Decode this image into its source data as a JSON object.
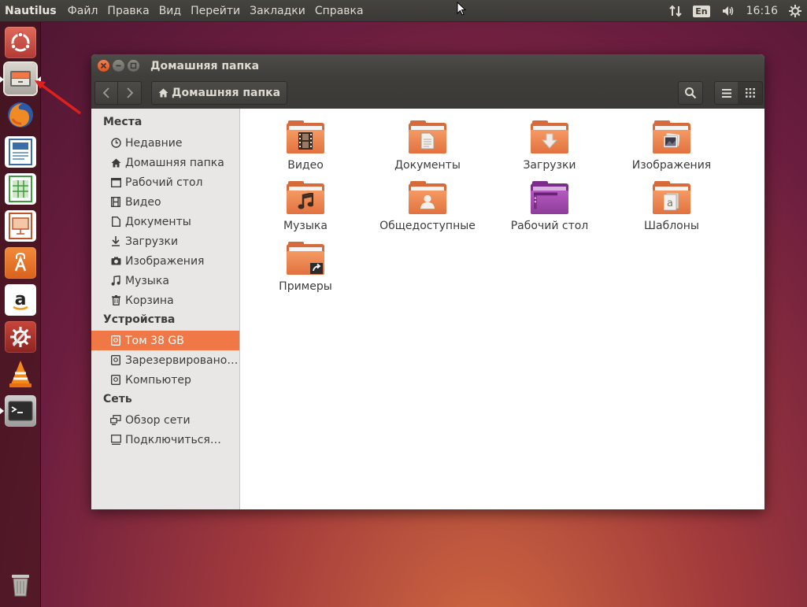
{
  "top_panel": {
    "app_name": "Nautilus",
    "menu": [
      "Файл",
      "Правка",
      "Вид",
      "Перейти",
      "Закладки",
      "Справка"
    ],
    "lang": "En",
    "time": "16:16"
  },
  "launcher": {
    "items": [
      "ubuntu-dash-icon",
      "files-icon",
      "firefox-icon",
      "writer-icon",
      "calc-icon",
      "impress-icon",
      "software-center-icon",
      "amazon-icon",
      "system-settings-icon",
      "vlc-icon",
      "terminal-icon",
      "trash-icon"
    ]
  },
  "window": {
    "title": "Домашняя папка",
    "path_button": "Домашняя папка"
  },
  "sidebar": {
    "places_header": "Места",
    "places": [
      "Недавние",
      "Домашняя папка",
      "Рабочий стол",
      "Видео",
      "Документы",
      "Загрузки",
      "Изображения",
      "Музыка",
      "Корзина"
    ],
    "devices_header": "Устройства",
    "devices": [
      "Том 38 GB",
      "Зарезервировано…",
      "Компьютер"
    ],
    "network_header": "Сеть",
    "network": [
      "Обзор сети",
      "Подключиться…"
    ]
  },
  "files": [
    {
      "name": "Видео",
      "icon": "video-folder-icon"
    },
    {
      "name": "Документы",
      "icon": "documents-folder-icon"
    },
    {
      "name": "Загрузки",
      "icon": "downloads-folder-icon"
    },
    {
      "name": "Изображения",
      "icon": "pictures-folder-icon"
    },
    {
      "name": "Музыка",
      "icon": "music-folder-icon"
    },
    {
      "name": "Общедоступные",
      "icon": "public-folder-icon"
    },
    {
      "name": "Рабочий стол",
      "icon": "desktop-folder-icon"
    },
    {
      "name": "Шаблоны",
      "icon": "templates-folder-icon"
    },
    {
      "name": "Примеры",
      "icon": "examples-folder-icon"
    }
  ],
  "colors": {
    "accent": "#f07746",
    "panel": "#3a3935",
    "folder": "#e2723f"
  }
}
